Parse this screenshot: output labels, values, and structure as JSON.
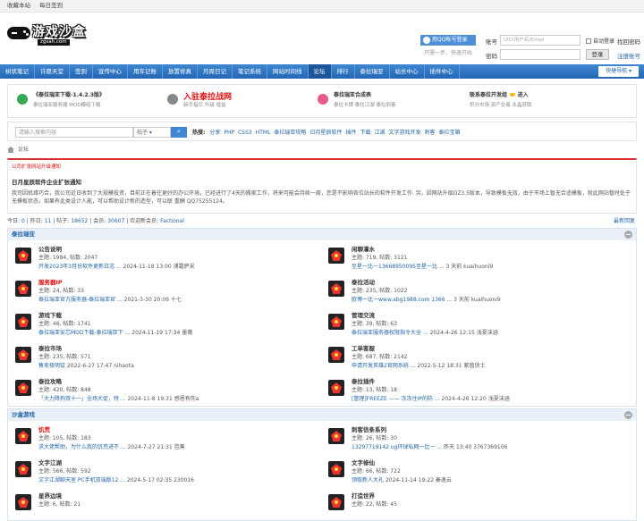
{
  "topbar": {
    "bookmark": "收藏本站",
    "checkin": "每日签到"
  },
  "logo": {
    "name": "游戏沙盒",
    "url": "zgsah.com"
  },
  "login": {
    "qq_button": "用QQ帐号登录",
    "qq_tip": "只需一步，快速开始",
    "account_label": "账号",
    "account_placeholder": "UID/用户名/Email",
    "auto_login": "自动登录",
    "forgot": "找回密码",
    "password_label": "密码",
    "login_button": "登录",
    "register": "注册账号"
  },
  "nav": {
    "items": [
      "树状笔记",
      "许愿天堂",
      "签到",
      "宣传中心",
      "用车记账",
      "放置修真",
      "月周日记",
      "笔记系统",
      "网站时间线",
      "论坛",
      "排行",
      "泰拉瑞亚",
      "站长中心",
      "插件中心"
    ],
    "current_index": 9,
    "quick": "快捷导航 ▾"
  },
  "promo": [
    {
      "title": "《泰拉瑞亚下载-1.4.2.3版》",
      "sub": "泰拉瑞亚服务器    MOD模组下载",
      "color": "#35a853"
    },
    {
      "title": "入驻泰拉战网",
      "sub": "新手指引    升级    增益",
      "color": "#888888"
    },
    {
      "title": "泰拉瑞亚合成表",
      "sub": "泰拉卡牌    泰拉江湖    泰拉刺客",
      "color": "#e95b8a"
    },
    {
      "title": "联系泰拉开发组 🤝 进入",
      "sub": "积分市场    资产交易    永晶获取",
      "color": "#ffffff"
    }
  ],
  "search": {
    "placeholder": "请输入搜索内容",
    "type": "帖子 ▾",
    "hot_label": "热搜:",
    "hot": [
      "分享",
      "PHP",
      "CSS3",
      "HTML",
      "泰拉瑞亚攻略",
      "日月星辰软件",
      "插件",
      "下载",
      "江湖",
      "文字游戏开发",
      "刺客",
      "泰拉宝箱"
    ]
  },
  "breadcrumb": "论坛",
  "notice": {
    "header": "公司扩张网站升级通知",
    "title": "日月星辰软件企业扩张通知",
    "body": "我司因机缘巧合，我公司近日收到了大规模投资，目前正在着往更好的办公环境，已经进行了4天的搬家工作，将来可能会持续一周，您是不影响各位站长的软件开发工作. 另，因网站升级DZ3.5版本，导致模板无效，由于市场上暂无合适模板，就此网站暂时处于无模板状态，如果有此类设计人能，可以帮助设计新的造型，可以联 重酬 QQ75255124。"
  },
  "stats": {
    "today_label": "今日:",
    "today": "0",
    "yesterday_label": "昨日:",
    "yesterday": "11",
    "posts_label": "帖子:",
    "posts": "18652",
    "members_label": "会员:",
    "members": "30607",
    "welcome_label": "欢迎新会员:",
    "newest_member": "Factional",
    "latest_reply": "最新回复"
  },
  "groups": [
    {
      "title": "泰拉瑞亚",
      "forums": [
        {
          "name": "公告说明",
          "stat": "主题: 1984, 帖数: 2047",
          "last_title": "开发2023年3月份软件更新日志 ...",
          "last_meta": "2024-11-18 13:00 浦霜萨采"
        },
        {
          "name": "闲聊灌水",
          "stat": "主题: 719, 帖数: 3121",
          "last_title": "至星一比一13668950095至星一比 ...",
          "last_meta": "3 天前 kuaihuoni9"
        },
        {
          "name": "服务器IP",
          "red": true,
          "stat": "主题: 24, 帖数: 33",
          "last_title": "泰拉瑞亚官方服务器-泰拉瑞亚官 ...",
          "last_meta": "2021-3-30 20:09 十七"
        },
        {
          "name": "泰拉活动",
          "stat": "主题: 235, 帖数: 1022",
          "last_title": "欧博一比一www.abg1988.com 1366 ...",
          "last_meta": "3 天前 kuaihuoni9"
        },
        {
          "name": "游戏下载",
          "stat": "主题: 46, 帖数: 1741",
          "last_title": "泰拉瑞亚安芯MOD下载-泰拉瑞亚下 ...",
          "last_meta": "2024-11-19 17:34 墨薇"
        },
        {
          "name": "管理交流",
          "stat": "主题: 39, 帖数: 63",
          "last_title": "泰拉瑞亚服务器权限指令大全 ...",
          "last_meta": "2024-4-26 12:15 浅夏沫涵"
        },
        {
          "name": "泰拉市场",
          "stat": "主题: 235, 帖数: 571",
          "last_title": "售卖夜明锭",
          "last_meta": "2022-6-27 17:47 nihaota"
        },
        {
          "name": "工单客服",
          "stat": "主题: 687, 帖数: 2142",
          "last_title": "申请开发英雄2官网系统 ...",
          "last_meta": "2022-5-12 18:31 萦茵侠士"
        },
        {
          "name": "泰拉攻略",
          "stat": "主题: 420, 帖数: 848",
          "last_title": "「大力降狗双十一」全场大促，特 ...",
          "last_meta": "2024-11-8 19:31 感恩有你a"
        },
        {
          "name": "泰拉插件",
          "stat": "主题: 13, 帖数: 18",
          "last_title": "[管理]FREEZE —— 冻冻住IP的防 ...",
          "last_meta": "2024-4-26 12:20 浅夏沫涵"
        }
      ]
    },
    {
      "title": "沙盒游戏",
      "forums": [
        {
          "name": "饥荒",
          "red": true,
          "stat": "主题: 105, 帖数: 183",
          "last_title": "求大佬帮助，为什么我的饥荒进不 ...",
          "last_meta": "2024-7-27 21:31 芭蕉"
        },
        {
          "name": "刺客信条系列",
          "stat": "主题: 26, 帖数: 30",
          "last_title": "13297719142 ug环球私网一比一 ...",
          "last_meta": "昨天 13:40 3767369106"
        },
        {
          "name": "文字江湖",
          "stat": "主题: 566, 帖数: 592",
          "last_title": "文字江湖聊天室 PC手机双端版12 ...",
          "last_meta": "2024-5-17 02:35 230016"
        },
        {
          "name": "文字修仙",
          "stat": "主题: 66, 帖数: 722",
          "last_title": "领取新人大礼",
          "last_meta": "2024-11-14 19:22 秦逸云"
        },
        {
          "name": "星界边境",
          "stat": "主题: 6, 帖数: 21",
          "last_title": "",
          "last_meta": ""
        },
        {
          "name": "打造世界",
          "stat": "主题: 22, 帖数: 45",
          "last_title": "",
          "last_meta": ""
        }
      ]
    }
  ]
}
